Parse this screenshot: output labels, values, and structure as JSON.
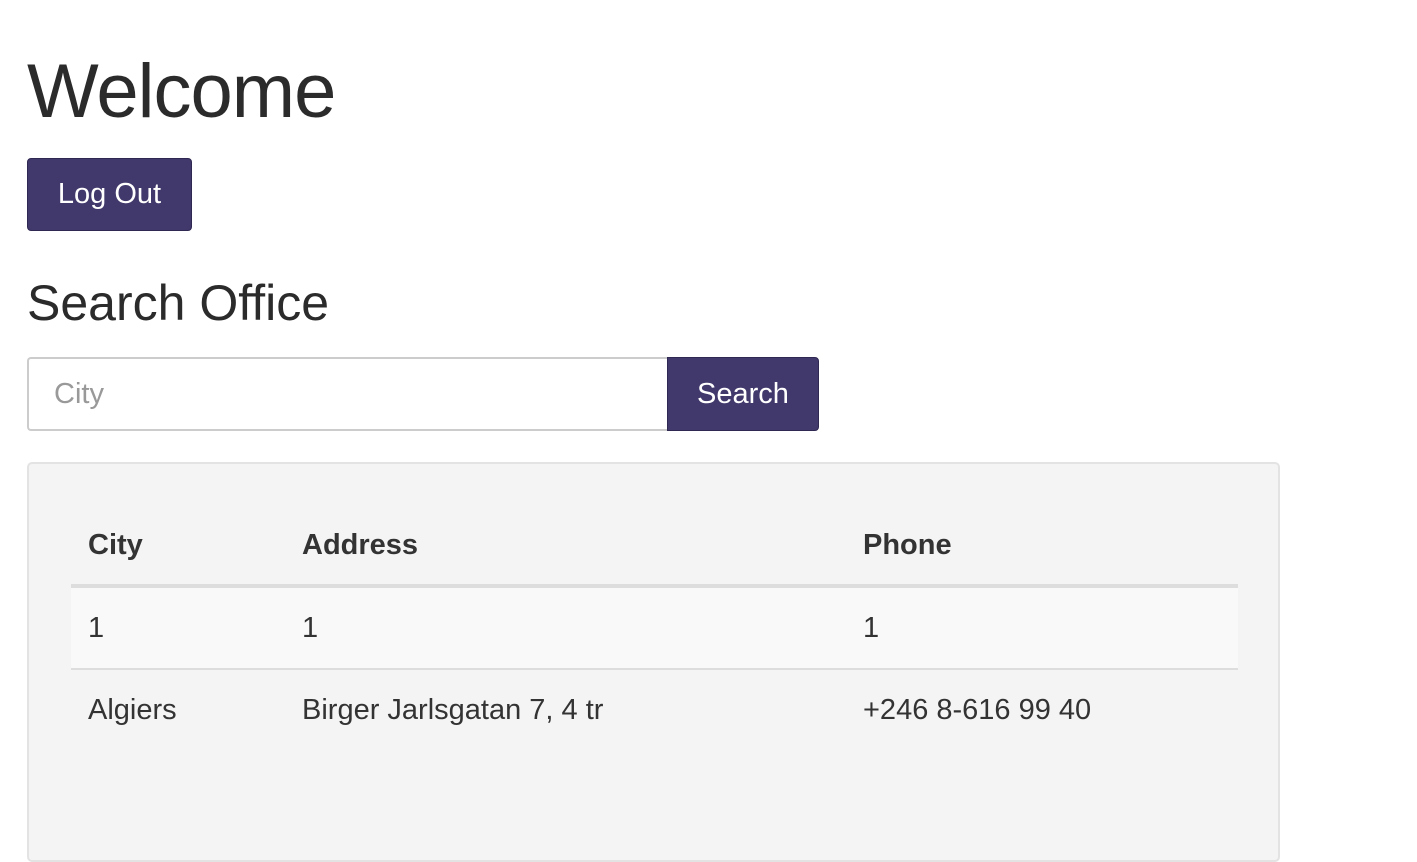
{
  "page": {
    "welcome_heading": "Welcome",
    "logout_label": "Log Out"
  },
  "search": {
    "title": "Search Office",
    "placeholder": "City",
    "value": "",
    "button_label": "Search"
  },
  "results": {
    "columns": [
      "City",
      "Address",
      "Phone"
    ],
    "rows": [
      [
        "1",
        "1",
        "1"
      ],
      [
        "Algiers",
        "Birger Jarlsgatan 7, 4 tr",
        "+246 8-616 99 40"
      ]
    ]
  },
  "colors": {
    "accent": "#41386b",
    "panel_background": "#f4f4f4"
  }
}
